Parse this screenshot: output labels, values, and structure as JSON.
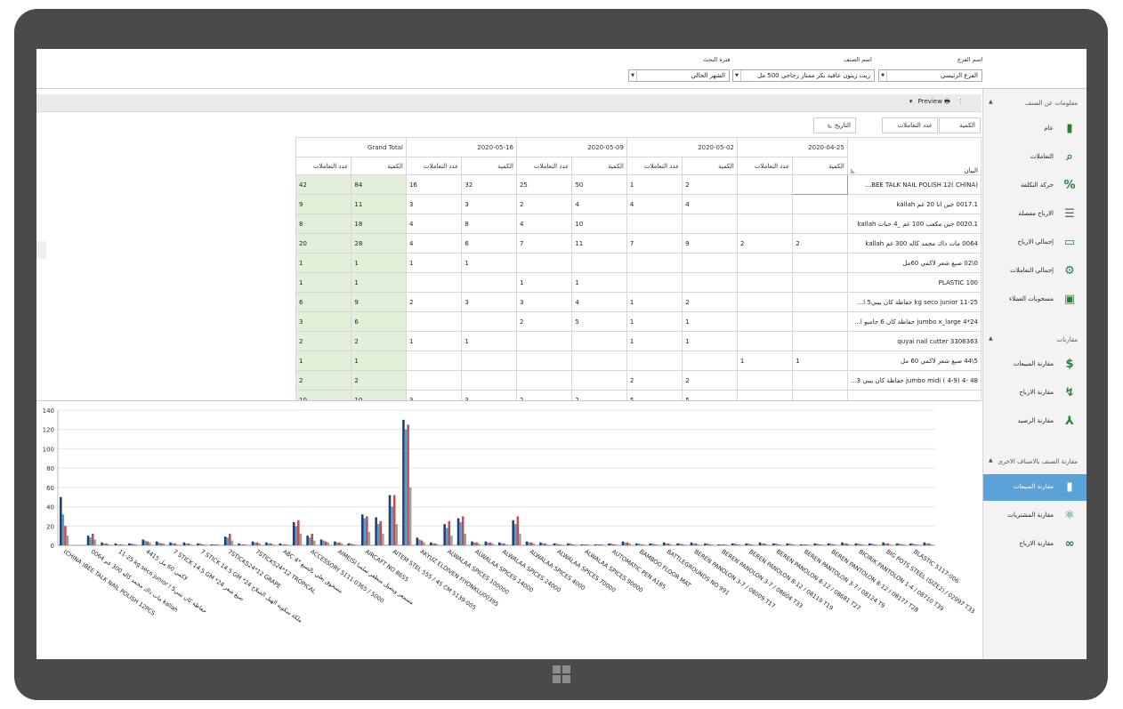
{
  "filters": {
    "branch": {
      "label": "اسم الفرع",
      "value": "الفرع الرئيسي"
    },
    "item": {
      "label": "اسم الصنف",
      "value": "زيت زيتون عافية بكر ممتاز زجاجي  500 مل"
    },
    "period": {
      "label": "فترة البحث",
      "value": "الشهر الحالي"
    }
  },
  "toolbar": {
    "preview": "Preview"
  },
  "sidebar": {
    "section1": "معلومات عن الصنف",
    "items1": [
      {
        "label": "عام",
        "icon": "bar-chart-icon"
      },
      {
        "label": "التعاملات",
        "icon": "document-search-icon"
      },
      {
        "label": "حركة التكلفة",
        "icon": "percent-icon"
      },
      {
        "label": "الارباح مفصلة",
        "icon": "list-icon"
      },
      {
        "label": "إجمالي الارباح",
        "icon": "monitor-chart-icon"
      },
      {
        "label": "إجمالي التعاملات",
        "icon": "gear-bulb-icon"
      },
      {
        "label": "مسحوبات العملاء",
        "icon": "contact-card-icon"
      }
    ],
    "section2": "مقارنات",
    "items2": [
      {
        "label": "مقارنة المبيعات",
        "icon": "sale-icon"
      },
      {
        "label": "مقارنة الارباح",
        "icon": "trend-icon"
      },
      {
        "label": "مقارنة الرصيد",
        "icon": "split-icon"
      }
    ],
    "section3": "مقارنة الصنف بالاصناف الاخرى",
    "items3": [
      {
        "label": "مقارنة المبيعات",
        "icon": "bar-chart-up-icon"
      },
      {
        "label": "مقارنة المشتريات",
        "icon": "atom-icon"
      },
      {
        "label": "مقارنة الارباح",
        "icon": "binoculars-icon"
      }
    ],
    "selected": "مقارنة المبيعات"
  },
  "pivot": {
    "field_qty": "الكمية",
    "field_count": "عدد التعاملات",
    "field_date": "التاريخ",
    "field_label": "البيان",
    "dates": [
      "2020-04-25",
      "2020-05-02",
      "2020-05-09",
      "2020-05-16"
    ],
    "grand_total": "Grand Total",
    "qty_h": "الكمية",
    "count_h": "عدد التعاملات",
    "rows": [
      {
        "label": "(CHINA )BEE TALK NAIL POLISH 12...",
        "v": [
          "",
          "",
          "2",
          "1",
          "50",
          "25",
          "32",
          "16",
          "84",
          "42"
        ]
      },
      {
        "label": "0017.1 جين انا 20 غم kallah",
        "v": [
          "",
          "",
          "4",
          "4",
          "4",
          "2",
          "3",
          "3",
          "11",
          "9"
        ]
      },
      {
        "label": "0020.1 جين مكعب 100 غم _4 حبات kallah",
        "v": [
          "",
          "",
          "",
          "",
          "10",
          "4",
          "8",
          "4",
          "18",
          "8"
        ]
      },
      {
        "label": "0064 مات داك مجمد كاله 300 غم kallah",
        "v": [
          "2",
          "2",
          "9",
          "7",
          "11",
          "7",
          "6",
          "4",
          "28",
          "20"
        ]
      },
      {
        "label": "0\\02 صبغ شعر لاكمي 60مل",
        "v": [
          "",
          "",
          "",
          "",
          "",
          "",
          "1",
          "1",
          "1",
          "1"
        ]
      },
      {
        "label": "PLASTIC 100",
        "v": [
          "",
          "",
          "",
          "",
          "1",
          "1",
          "",
          "",
          "1",
          "1"
        ]
      },
      {
        "label": "11-25 kg seco junior حفاظة كان بيبي5 ا...",
        "v": [
          "",
          "",
          "2",
          "1",
          "4",
          "3",
          "3",
          "2",
          "9",
          "6"
        ]
      },
      {
        "label": "24*4 jumbo x_large حفاظة كان 6 جامبو ا...",
        "v": [
          "",
          "",
          "1",
          "1",
          "5",
          "2",
          "",
          "",
          "6",
          "3"
        ]
      },
      {
        "label": "quyai nail cutter 3306363",
        "v": [
          "",
          "",
          "1",
          "1",
          "",
          "",
          "1",
          "1",
          "2",
          "2"
        ]
      },
      {
        "label": "5\\44 صبغ شعر لاكمي 60 مل",
        "v": [
          "1",
          "1",
          "",
          "",
          "",
          "",
          "",
          "",
          "1",
          "1"
        ]
      },
      {
        "label": "48 -4 (4-9 ) jumbo midi حفاظة كان بيبي 3...",
        "v": [
          "",
          "",
          "2",
          "2",
          "",
          "",
          "",
          "",
          "2",
          "2"
        ]
      },
      {
        "label": "...",
        "v": [
          "",
          "",
          "5",
          "5",
          "2",
          "2",
          "3",
          "3",
          "10",
          "10"
        ]
      }
    ]
  },
  "chart_data": {
    "type": "bar",
    "yticks": [
      0,
      20,
      40,
      60,
      80,
      100,
      120,
      140
    ],
    "ylim": [
      0,
      140
    ],
    "series_colors": [
      "#1f3e6e",
      "#5b9bd5",
      "#c0504d",
      "#9e9e9e"
    ],
    "labels": [
      "(CHINA )BEE TALK NAIL POLISH 12PCS",
      "0064 مات داك مجمد كاله 300 غم kallah",
      "11-25 kg seco junior حفاظة كان بيبي5 ا",
      "4415 لاكمي 60 مل",
      "7 STICK 14.5 GM *24 صبغ شعر",
      "7 STICK 14.5 GM *24 ملكة سكوية الهيل الصلاح",
      "7STICKS24*12 GRAPE",
      "7STICKS24*12 TROPICAL",
      "ABC 4* مسحوق بعلي بالصبغ",
      "ACCESSORY 5111-0365 / 5000",
      "AIMEISI مسمعر ويصيل منظفر سلسا",
      "AIRCAFT NO 8655",
      "AITEM STEL 555 / 45 CM 5139-005",
      "AKYUZ ELDIVEN FIYONKLU00395",
      "ALWALAA SPICES 100000",
      "ALWALAA SPICES 14000",
      "ALWALAA SPICES 24000",
      "ALWALAA SPICES 4000",
      "ALWALAA SPICES 70000",
      "ALWALAA SPICES 90000",
      "AUTOMATIC PEN A185",
      "BAMBOO FLOOR MAT",
      "BATTLEGROUNDS NO 991",
      "BEREN PANOLON 3-7 / 08009 T17",
      "BEREN PANOLON 3-7 / 08604 T33",
      "BEREN PANOLON 8-12 / 08119 T19",
      "BEREN PANOLON 8-12 / 08681 T27",
      "BEREN PANTOLON 3-7 / 08124 T9",
      "BEREN PANTOLON 8-12 / 08177 T28",
      "BICIRIK PANTOLON 1-4 / 08710 T39",
      "BIG POTS STEEL (SIZE2) / 02997 T33",
      "BLASTIC 5117-006"
    ],
    "series": [
      {
        "values": [
          50,
          0,
          10,
          3,
          2,
          2,
          6,
          4,
          3,
          3,
          2,
          1,
          9,
          2,
          4,
          3,
          2,
          24,
          10,
          6,
          4,
          2,
          32,
          29,
          52,
          130,
          8,
          3,
          22,
          28,
          4,
          4,
          3,
          26,
          4,
          3,
          2,
          2,
          1,
          1,
          2,
          4,
          2,
          2,
          3,
          2,
          3,
          2,
          1,
          2,
          2,
          3,
          2,
          2,
          1,
          2,
          2,
          3,
          2,
          2,
          3,
          2,
          2,
          3
        ]
      },
      {
        "values": [
          32,
          0,
          8,
          2,
          1,
          2,
          5,
          3,
          2,
          2,
          2,
          1,
          8,
          1,
          3,
          2,
          1,
          20,
          8,
          5,
          3,
          2,
          28,
          22,
          40,
          120,
          6,
          2,
          18,
          24,
          3,
          3,
          2,
          22,
          3,
          2,
          2,
          2,
          1,
          1,
          2,
          3,
          2,
          2,
          2,
          2,
          2,
          2,
          1,
          2,
          2,
          2,
          2,
          2,
          1,
          2,
          2,
          2,
          2,
          2,
          2,
          2,
          2,
          2
        ]
      },
      {
        "values": [
          20,
          0,
          12,
          2,
          1,
          1,
          4,
          2,
          2,
          2,
          1,
          1,
          12,
          1,
          3,
          2,
          1,
          26,
          12,
          4,
          3,
          1,
          30,
          25,
          52,
          125,
          5,
          2,
          25,
          30,
          3,
          3,
          2,
          30,
          3,
          2,
          1,
          1,
          1,
          1,
          1,
          3,
          1,
          1,
          2,
          1,
          2,
          1,
          1,
          1,
          1,
          2,
          1,
          1,
          1,
          1,
          1,
          2,
          1,
          1,
          2,
          1,
          1,
          2
        ]
      },
      {
        "values": [
          10,
          0,
          6,
          1,
          1,
          1,
          3,
          2,
          1,
          1,
          1,
          1,
          5,
          1,
          2,
          1,
          1,
          12,
          5,
          3,
          2,
          1,
          14,
          12,
          22,
          60,
          3,
          1,
          10,
          12,
          2,
          2,
          1,
          12,
          2,
          1,
          1,
          1,
          1,
          1,
          1,
          2,
          1,
          1,
          1,
          1,
          1,
          1,
          1,
          1,
          1,
          1,
          1,
          1,
          1,
          1,
          1,
          1,
          1,
          1,
          1,
          1,
          1,
          1
        ]
      }
    ]
  }
}
